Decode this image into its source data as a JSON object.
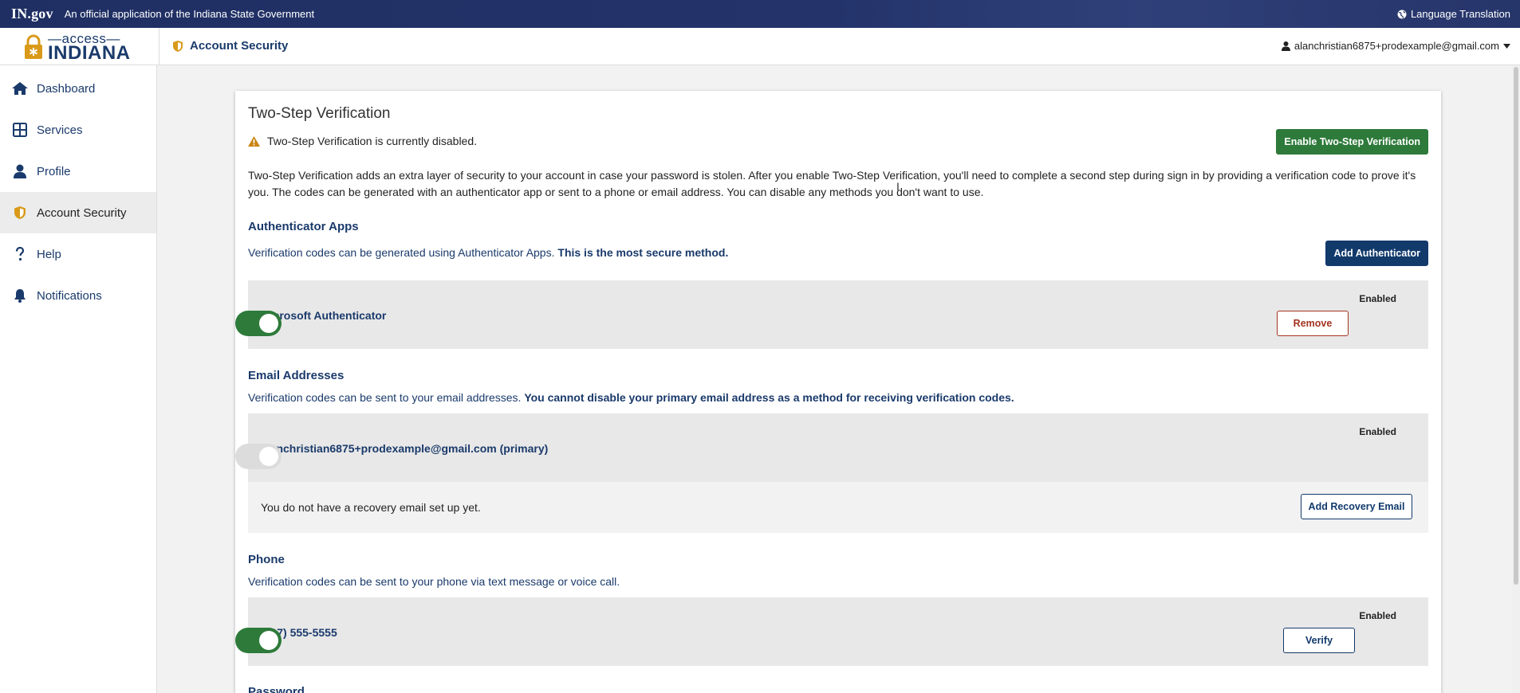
{
  "statebar": {
    "ingov": "IN.gov",
    "official": "An official application of the Indiana State Government",
    "language": "Language Translation"
  },
  "header": {
    "logo_small": "—access—",
    "logo_big": "INDIANA",
    "page_title": "Account Security",
    "user_email": "alanchristian6875+prodexample@gmail.com"
  },
  "sidebar": {
    "items": [
      {
        "label": "Dashboard",
        "icon": "home-icon"
      },
      {
        "label": "Services",
        "icon": "grid-icon"
      },
      {
        "label": "Profile",
        "icon": "person-icon"
      },
      {
        "label": "Account Security",
        "icon": "shield-icon",
        "active": true
      },
      {
        "label": "Help",
        "icon": "question-icon"
      },
      {
        "label": "Notifications",
        "icon": "bell-icon"
      }
    ]
  },
  "main": {
    "title": "Two-Step Verification",
    "warning": "Two-Step Verification is currently disabled.",
    "enable_button": "Enable Two-Step Verification",
    "description": "Two-Step Verification adds an extra layer of security to your account in case your password is stolen. After you enable Two-Step Verification, you'll need to complete a second step during sign in by providing a verification code to prove it's you. The codes can be generated with an authenticator app or sent to a phone or email address. You can disable any methods you don't want to use.",
    "authenticator": {
      "heading": "Authenticator Apps",
      "desc": "Verification codes can be generated using Authenticator Apps.",
      "desc_bold": "This is the most secure method.",
      "add_button": "Add Authenticator",
      "item_name": "Microsoft Authenticator",
      "enabled_label": "Enabled",
      "remove_button": "Remove",
      "enabled": true
    },
    "email": {
      "heading": "Email Addresses",
      "desc": "Verification codes can be sent to your email addresses.",
      "desc_bold": "You cannot disable your primary email address as a method for receiving verification codes.",
      "primary": "alanchristian6875+prodexample@gmail.com (primary)",
      "enabled_label": "Enabled",
      "enabled": false,
      "recovery_text": "You do not have a recovery email set up yet.",
      "recovery_button": "Add Recovery Email"
    },
    "phone": {
      "heading": "Phone",
      "desc": "Verification codes can be sent to your phone via text message or voice call.",
      "number": "(317) 555-5555",
      "enabled_label": "Enabled",
      "verify_button": "Verify",
      "enabled": true
    },
    "next_heading": "Password"
  },
  "colors": {
    "brand_navy": "#123a6b",
    "success_green": "#2d7a3a",
    "danger_red": "#a33420",
    "gold": "#d99a1a"
  }
}
